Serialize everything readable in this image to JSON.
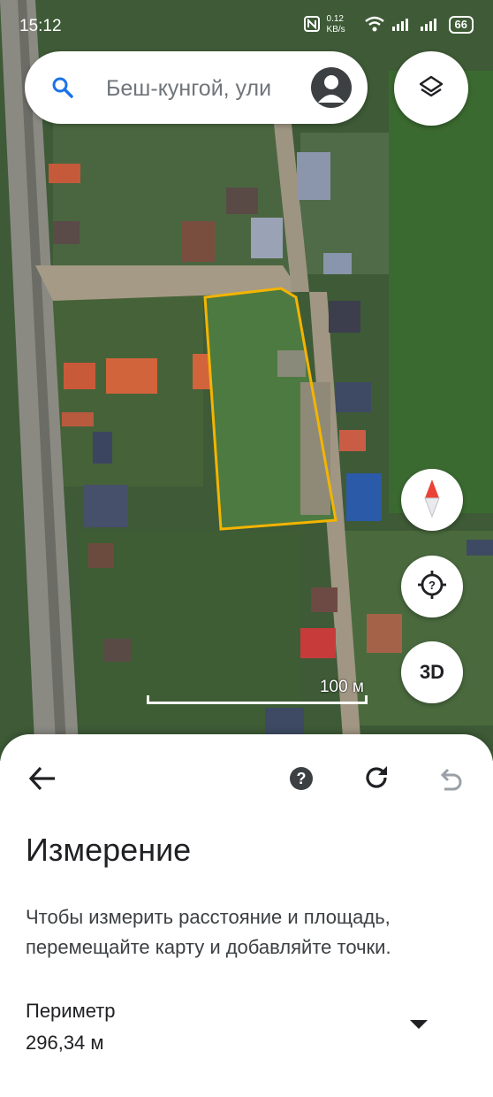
{
  "status_bar": {
    "time": "15:12",
    "net_speed": "0.12 KB/s",
    "battery": "66"
  },
  "search": {
    "placeholder": "Беш-кунгой, ули"
  },
  "map": {
    "scale_label": "100 м",
    "threed_label": "3D",
    "outline_color": "#f4b400"
  },
  "measure_panel": {
    "title": "Измерение",
    "description": "Чтобы измерить расстояние и площадь, перемещайте карту и добавляйте точки.",
    "perimeter_label": "Периметр",
    "perimeter_value": "296,34 м",
    "help_glyph": "?"
  }
}
